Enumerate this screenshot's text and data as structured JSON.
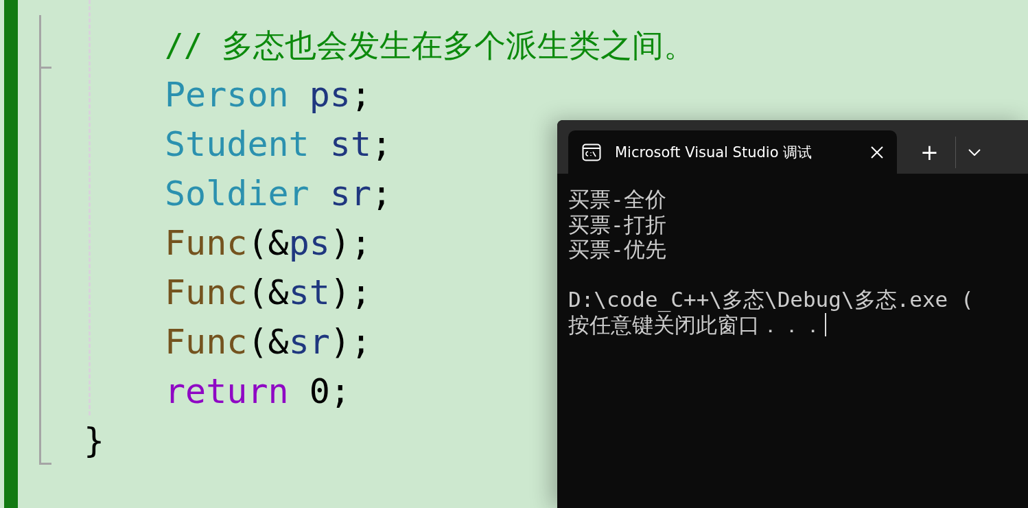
{
  "editor": {
    "body_lines": [
      {
        "tokens": [
          {
            "text": "// 多态也会发生在多个派生类之间。",
            "kind": "comment"
          }
        ]
      },
      {
        "tokens": [
          {
            "text": "Person ",
            "kind": "type"
          },
          {
            "text": "ps",
            "kind": "variable"
          },
          {
            "text": ";",
            "kind": "plain"
          }
        ]
      },
      {
        "tokens": [
          {
            "text": "Student ",
            "kind": "type"
          },
          {
            "text": "st",
            "kind": "variable"
          },
          {
            "text": ";",
            "kind": "plain"
          }
        ]
      },
      {
        "tokens": [
          {
            "text": "Soldier ",
            "kind": "type"
          },
          {
            "text": "sr",
            "kind": "variable"
          },
          {
            "text": ";",
            "kind": "plain"
          }
        ]
      },
      {
        "tokens": [
          {
            "text": "Func",
            "kind": "function"
          },
          {
            "text": "(&",
            "kind": "plain"
          },
          {
            "text": "ps",
            "kind": "variable"
          },
          {
            "text": ");",
            "kind": "plain"
          }
        ]
      },
      {
        "tokens": [
          {
            "text": "Func",
            "kind": "function"
          },
          {
            "text": "(&",
            "kind": "plain"
          },
          {
            "text": "st",
            "kind": "variable"
          },
          {
            "text": ");",
            "kind": "plain"
          }
        ]
      },
      {
        "tokens": [
          {
            "text": "Func",
            "kind": "function"
          },
          {
            "text": "(&",
            "kind": "plain"
          },
          {
            "text": "sr",
            "kind": "variable"
          },
          {
            "text": ");",
            "kind": "plain"
          }
        ]
      },
      {
        "tokens": [
          {
            "text": "return",
            "kind": "keyword"
          },
          {
            "text": " 0;",
            "kind": "plain"
          }
        ]
      }
    ],
    "closing_brace": "}"
  },
  "console": {
    "tab": {
      "title": "Microsoft Visual Studio 调试",
      "selected": true
    },
    "new_tab": "+",
    "output_blocks": [
      [
        "买票-全价",
        "买票-打折",
        "买票-优先"
      ],
      [
        "D:\\code_C++\\多态\\Debug\\多态.exe (",
        "按任意键关闭此窗口．．．"
      ]
    ],
    "cursor_visible": true
  }
}
